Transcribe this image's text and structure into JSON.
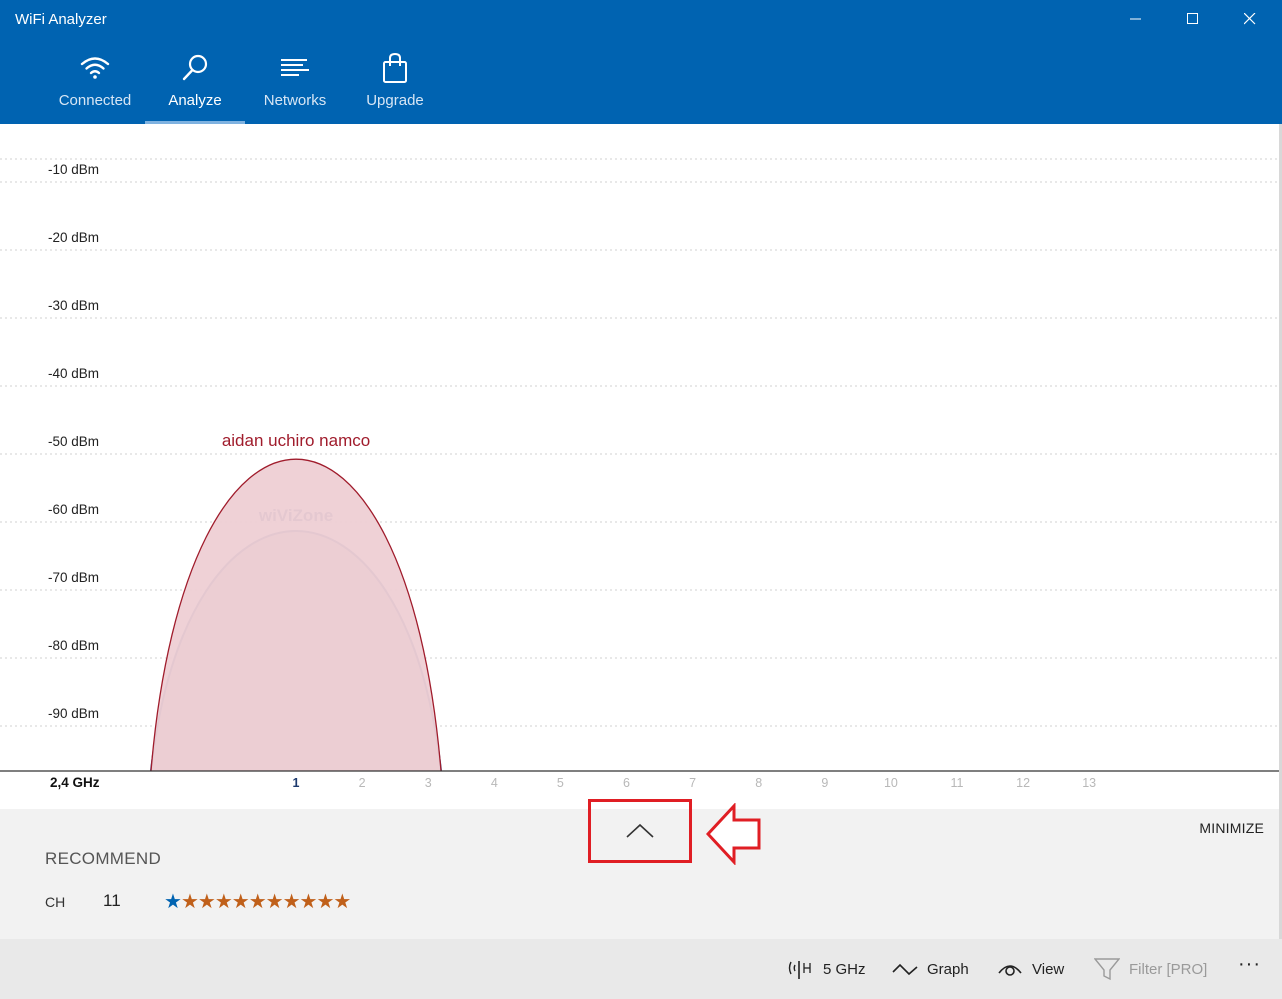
{
  "window": {
    "title": "WiFi Analyzer",
    "minimize_glyph": "—",
    "maximize_glyph": "☐",
    "close_glyph": "✕"
  },
  "tabs": [
    {
      "label": "Connected",
      "icon": "wifi-icon",
      "active": false
    },
    {
      "label": "Analyze",
      "icon": "magnifier-icon",
      "active": true
    },
    {
      "label": "Networks",
      "icon": "networks-list-icon",
      "active": false
    },
    {
      "label": "Upgrade",
      "icon": "shopping-bag-icon",
      "active": false
    }
  ],
  "chart_data": {
    "type": "area",
    "band_label": "2,4 GHz",
    "y_unit": "dBm",
    "ylim": [
      -100,
      0
    ],
    "y_ticks": [
      -10,
      -20,
      -30,
      -40,
      -50,
      -60,
      -70,
      -80,
      -90
    ],
    "y_tick_labels": [
      "-10 dBm",
      "-20 dBm",
      "-30 dBm",
      "-40 dBm",
      "-50 dBm",
      "-60 dBm",
      "-70 dBm",
      "-80 dBm",
      "-90 dBm"
    ],
    "x_ticks": [
      "1",
      "2",
      "3",
      "4",
      "5",
      "6",
      "7",
      "8",
      "9",
      "10",
      "11",
      "12",
      "13"
    ],
    "active_channel": "1",
    "grid": true,
    "series": [
      {
        "name": "aidan uchiro namco",
        "channel": 1,
        "signal": -50,
        "color": "#a01c2c",
        "fill": "#eecfd4"
      },
      {
        "name": "wiViZone",
        "channel": 1,
        "signal": -61,
        "color": "#2a4a8c",
        "fill": "#c4b3c6"
      }
    ]
  },
  "panel": {
    "minimize_label": "MINIMIZE",
    "recommend_title": "RECOMMEND",
    "ch_label": "CH",
    "ch_value": "11",
    "rating": {
      "blue_stars": 1,
      "orange_stars": 10
    },
    "annotation_color": "#e01e24"
  },
  "commands": {
    "band": "5 GHz",
    "graph": "Graph",
    "view": "View",
    "filter": "Filter [PRO]",
    "more": "···"
  }
}
